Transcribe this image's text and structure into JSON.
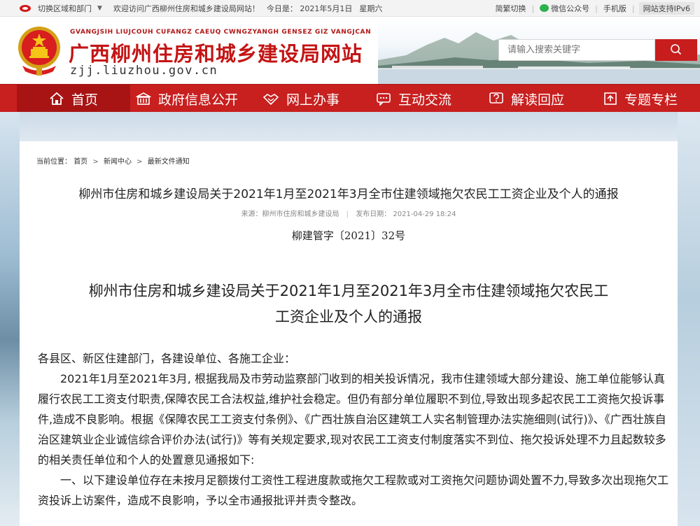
{
  "topbar": {
    "region": "切换区域和部门",
    "welcome": "欢迎访问广西柳州住房和城乡建设局网站！",
    "date": "今日是：  2021年5月1日",
    "weekday": "星期六",
    "links": [
      "简繁切换",
      "微信公众号",
      "手机版"
    ],
    "ipv6": "网站支持IPv6"
  },
  "header": {
    "pinyin": "GVANGJSIH LIUJCOUH CUFANGZ CAEUQ CWNGZYANGH GENSEZ GIZ VANGJCAN",
    "title": "广西柳州住房和城乡建设局网站",
    "domain": "zjj.liuzhou.gov.cn",
    "search_placeholder": "请输入搜索关键字"
  },
  "nav": {
    "items": [
      "首页",
      "政府信息公开",
      "网上办事",
      "互动交流",
      "解读回应",
      "专题专栏"
    ]
  },
  "breadcrumb": {
    "label": "当前位置：",
    "items": [
      "首页",
      "新闻中心",
      "最新文件通知"
    ]
  },
  "article": {
    "title": "柳州市住房和城乡建设局关于2021年1月至2021年3月全市住建领域拖欠农民工工资企业及个人的通报",
    "source": "来源：柳州市住房和城乡建设局",
    "published": "发布日期：  2021-04-29 18:24",
    "doc_number": "柳建管字〔2021〕32号",
    "doc_title_line1": "柳州市住房和城乡建设局关于2021年1月至2021年3月全市住建领域拖欠农民工",
    "doc_title_line2": "工资企业及个人的通报",
    "salutation": "各县区、新区住建部门，各建设单位、各施工企业：",
    "paragraph1": "2021年1月至2021年3月, 根据我局及市劳动监察部门收到的相关投诉情况，我市住建领域大部分建设、施工单位能够认真履行农民工工资支付职责,保障农民工合法权益,维护社会稳定。但仍有部分单位履职不到位,导致出现多起农民工工资拖欠投诉事件,造成不良影响。根据《保障农民工工资支付条例》、《广西壮族自治区建筑工人实名制管理办法实施细则(试行)》、《广西壮族自治区建筑业企业诚信综合评价办法(试行)》等有关规定要求,现对农民工工资支付制度落实不到位、拖欠投诉处理不力且起数较多的相关责任单位和个人的处置意见通报如下:",
    "paragraph2": "一、以下建设单位存在未按月足额拨付工资性工程进度款或拖欠工程款或对工资拖欠问题协调处置不力,导致多次出现拖欠工资投诉上访案件，造成不良影响，予以全市通报批评并责令整改。"
  },
  "colors": {
    "brand_red": "#c81f1f",
    "nav_active": "#a81414"
  }
}
